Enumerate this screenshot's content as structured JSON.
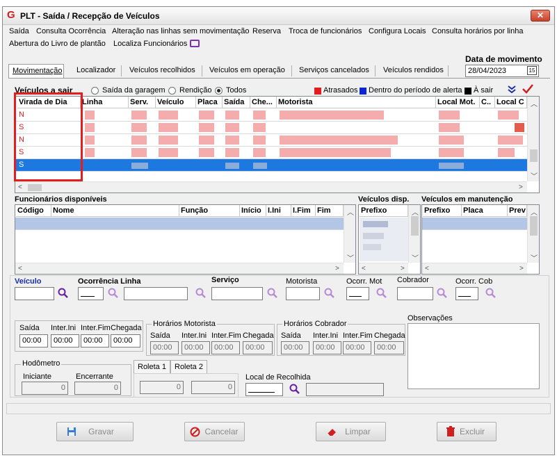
{
  "title": "PLT - Saída / Recepção de Veículos",
  "window": {
    "close": "✕",
    "logo": "G"
  },
  "menu": [
    "Saída",
    "Consulta Ocorrência",
    "Alteração nas linhas sem movimentação",
    "Reserva",
    "Troca de funcionários",
    "Configura Locais",
    "Consulta horários por linha",
    "Abertura do Livro de plantão",
    "Localiza Funcionários"
  ],
  "data_movimento": {
    "label": "Data de movimento",
    "value": "28/04/2023",
    "cal": "15"
  },
  "tabs": [
    "Movimentação",
    "Localizador",
    "Veículos recolhidos",
    "Veículos em operação",
    "Serviços cancelados",
    "Veículos rendidos"
  ],
  "veiculos": {
    "label": "Veículos a sair",
    "radios": [
      "Saída da garagem",
      "Rendição",
      "Todos"
    ],
    "legend": [
      {
        "label": "Atrasados",
        "color": "#e21d1d"
      },
      {
        "label": "Dentro do período de alerta",
        "color": "#0a24d6"
      },
      {
        "label": "À sair",
        "color": "#000000"
      }
    ],
    "columns": [
      "Virada de Dia",
      "Linha",
      "Serv.",
      "Veículo",
      "Placa",
      "Saída",
      "Che...",
      "Motorista",
      "Local Mot.",
      "C..",
      "Local C"
    ],
    "virada": [
      "N",
      "S",
      "N",
      "S",
      "S"
    ]
  },
  "funcionarios": {
    "label": "Funcionários disponíveis",
    "columns": [
      "Código",
      "Nome",
      "Função",
      "Início",
      "I.Ini",
      "I.Fim",
      "Fim"
    ]
  },
  "veiculos_disp": {
    "label": "Veículos disp.",
    "columns": [
      "Prefixo"
    ]
  },
  "manutencao": {
    "label": "Veículos em manutenção",
    "columns": [
      "Prefixo",
      "Placa",
      "Prev"
    ]
  },
  "form": {
    "veiculo": "Veículo",
    "ocorrencia_linha": "Ocorrência Linha",
    "servico": "Serviço",
    "motorista": "Motorista",
    "ocorr_mot": "Ocorr. Mot",
    "cobrador": "Cobrador",
    "ocorr_cob": "Ocorr. Cob",
    "observacoes": "Observações",
    "horarios": {
      "labels": [
        "Saída",
        "Inter.Ini",
        "Inter.Fim",
        "Chegada"
      ],
      "values": [
        "00:00",
        "00:00",
        "00:00",
        "00:00"
      ]
    },
    "horarios_motorista": {
      "label": "Horários Motorista",
      "labels": [
        "Saída",
        "Inter.Ini",
        "Inter.Fim",
        "Chegada"
      ],
      "values": [
        "00:00",
        "00:00",
        "00:00",
        "00:00"
      ]
    },
    "horarios_cobrador": {
      "label": "Horários Cobrador",
      "labels": [
        "Saída",
        "Inter.Ini",
        "Inter.Fim",
        "Chegada"
      ],
      "values": [
        "00:00",
        "00:00",
        "00:00",
        "00:00"
      ]
    },
    "hodometro": {
      "label": "Hodômetro",
      "iniciante": "Iniciante",
      "encerrante": "Encerrante",
      "ini_val": "0",
      "enc_val": "0"
    },
    "roleta": {
      "tab1": "Roleta 1",
      "tab2": "Roleta 2",
      "v1": "0",
      "v2": "0"
    },
    "local_recolhida": "Local de Recolhida"
  },
  "buttons": {
    "gravar": "Gravar",
    "cancelar": "Cancelar",
    "limpar": "Limpar",
    "excluir": "Excluir"
  }
}
